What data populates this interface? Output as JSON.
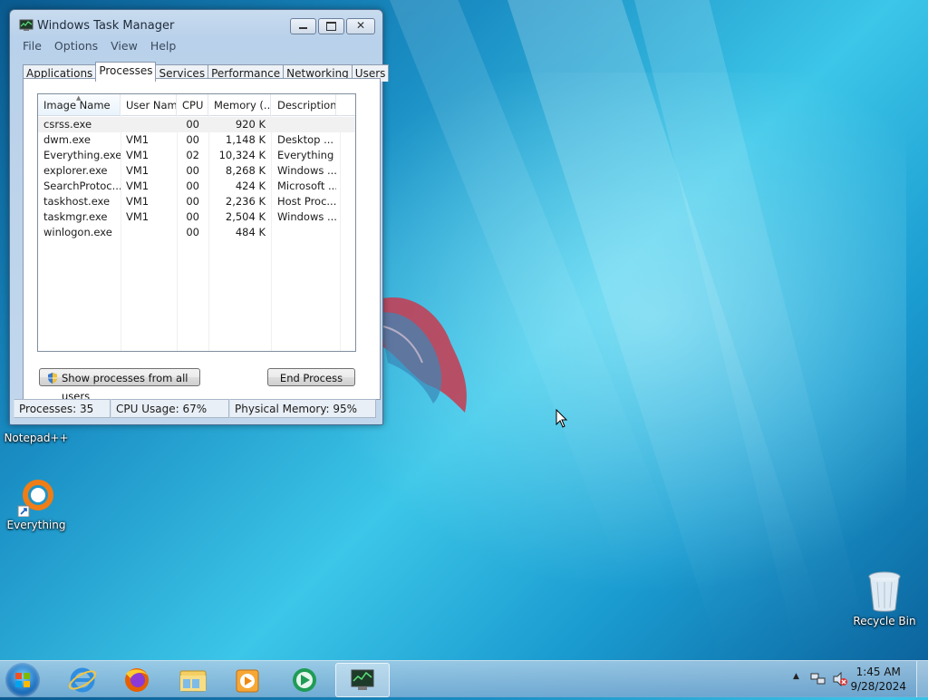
{
  "window": {
    "title": "Windows Task Manager",
    "menu": [
      "File",
      "Options",
      "View",
      "Help"
    ],
    "tabs": [
      "Applications",
      "Processes",
      "Services",
      "Performance",
      "Networking",
      "Users"
    ],
    "active_tab": "Processes",
    "columns": [
      "Image Name",
      "User Name",
      "CPU",
      "Memory (...",
      "Description"
    ],
    "rows": [
      {
        "image": "csrss.exe",
        "user": "",
        "cpu": "00",
        "mem": "920 K",
        "desc": ""
      },
      {
        "image": "dwm.exe",
        "user": "VM1",
        "cpu": "00",
        "mem": "1,148 K",
        "desc": "Desktop ..."
      },
      {
        "image": "Everything.exe",
        "user": "VM1",
        "cpu": "02",
        "mem": "10,324 K",
        "desc": "Everything"
      },
      {
        "image": "explorer.exe",
        "user": "VM1",
        "cpu": "00",
        "mem": "8,268 K",
        "desc": "Windows ..."
      },
      {
        "image": "SearchProtoc...",
        "user": "VM1",
        "cpu": "00",
        "mem": "424 K",
        "desc": "Microsoft ..."
      },
      {
        "image": "taskhost.exe",
        "user": "VM1",
        "cpu": "00",
        "mem": "2,236 K",
        "desc": "Host Proc..."
      },
      {
        "image": "taskmgr.exe",
        "user": "VM1",
        "cpu": "00",
        "mem": "2,504 K",
        "desc": "Windows ..."
      },
      {
        "image": "winlogon.exe",
        "user": "",
        "cpu": "00",
        "mem": "484 K",
        "desc": ""
      }
    ],
    "show_all_label": "Show processes from all users",
    "end_process_label": "End Process",
    "status": {
      "processes": "Processes: 35",
      "cpu": "CPU Usage: 67%",
      "memory": "Physical Memory: 95%"
    }
  },
  "desktop": {
    "icons": [
      {
        "label": "Notepad++",
        "icon": "notepad-plus-plus-icon"
      },
      {
        "label": "Everything",
        "icon": "everything-search-icon"
      },
      {
        "label": "Recycle Bin",
        "icon": "recycle-bin-icon"
      }
    ]
  },
  "taskbar": {
    "apps": [
      "internet-explorer-icon",
      "firefox-icon",
      "file-explorer-icon",
      "media-player-icon",
      "media-center-icon",
      "task-manager-icon"
    ],
    "clock_time": "1:45 AM",
    "clock_date": "9/28/2024"
  },
  "colors": {
    "window_frame": "#c2d7ec",
    "desktop_accent": "#1a8ec4",
    "everything_orange": "#f07d16"
  }
}
